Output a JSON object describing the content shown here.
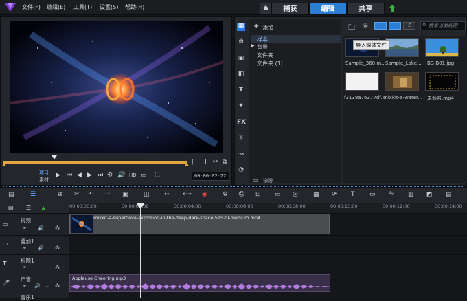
{
  "menubar": {
    "items": [
      "文件(F)",
      "编辑(E)",
      "工具(T)",
      "设置(S)",
      "帮助(H)"
    ],
    "modes": [
      {
        "label": "捕获",
        "active": false
      },
      {
        "label": "编辑",
        "active": true
      },
      {
        "label": "共享",
        "active": false
      }
    ]
  },
  "preview": {
    "mode_project": "项目",
    "mode_clip": "素材",
    "timecode": "00:00:02:22"
  },
  "library": {
    "add_label": "添加",
    "search_placeholder": "搜索当前视图",
    "browse_label": "浏览",
    "tooltip": "导入媒体文件",
    "folders": [
      {
        "label": "样本",
        "selected": true
      },
      {
        "label": "背景",
        "selected": false
      },
      {
        "label": "文件夹",
        "selected": false
      },
      {
        "label": "文件夹 (1)",
        "selected": false
      }
    ],
    "thumbnails": [
      {
        "caption": "Sample_360.m..."
      },
      {
        "caption": "Sample_Lake..."
      },
      {
        "caption": "BG-B01.jpg"
      },
      {
        "caption": "f3138a76377df..."
      },
      {
        "caption": "mixkit-a-water..."
      },
      {
        "caption": "未命名.mp4"
      }
    ]
  },
  "timeline": {
    "ruler": [
      "00:00:00:00",
      "00:00:02:00",
      "00:00:04:00",
      "00:00:06:00",
      "00:00:08:00",
      "00:00:10:00",
      "00:00:12:00",
      "00:00:14:00"
    ],
    "tracks": [
      {
        "name": "视频"
      },
      {
        "name": "叠加1"
      },
      {
        "name": "标题1"
      },
      {
        "name": "声音"
      },
      {
        "name": "音乐1"
      }
    ],
    "video_clip": "mixkit-a-supernova-explosion-in-the-deep-dark-space-51520-medium.mp4",
    "audio_clip": "Applause Cheering.mp3"
  },
  "colors": {
    "accent": "#2a7fd4",
    "scrub": "#e2a540",
    "audio_wave": "#b07ce0"
  }
}
